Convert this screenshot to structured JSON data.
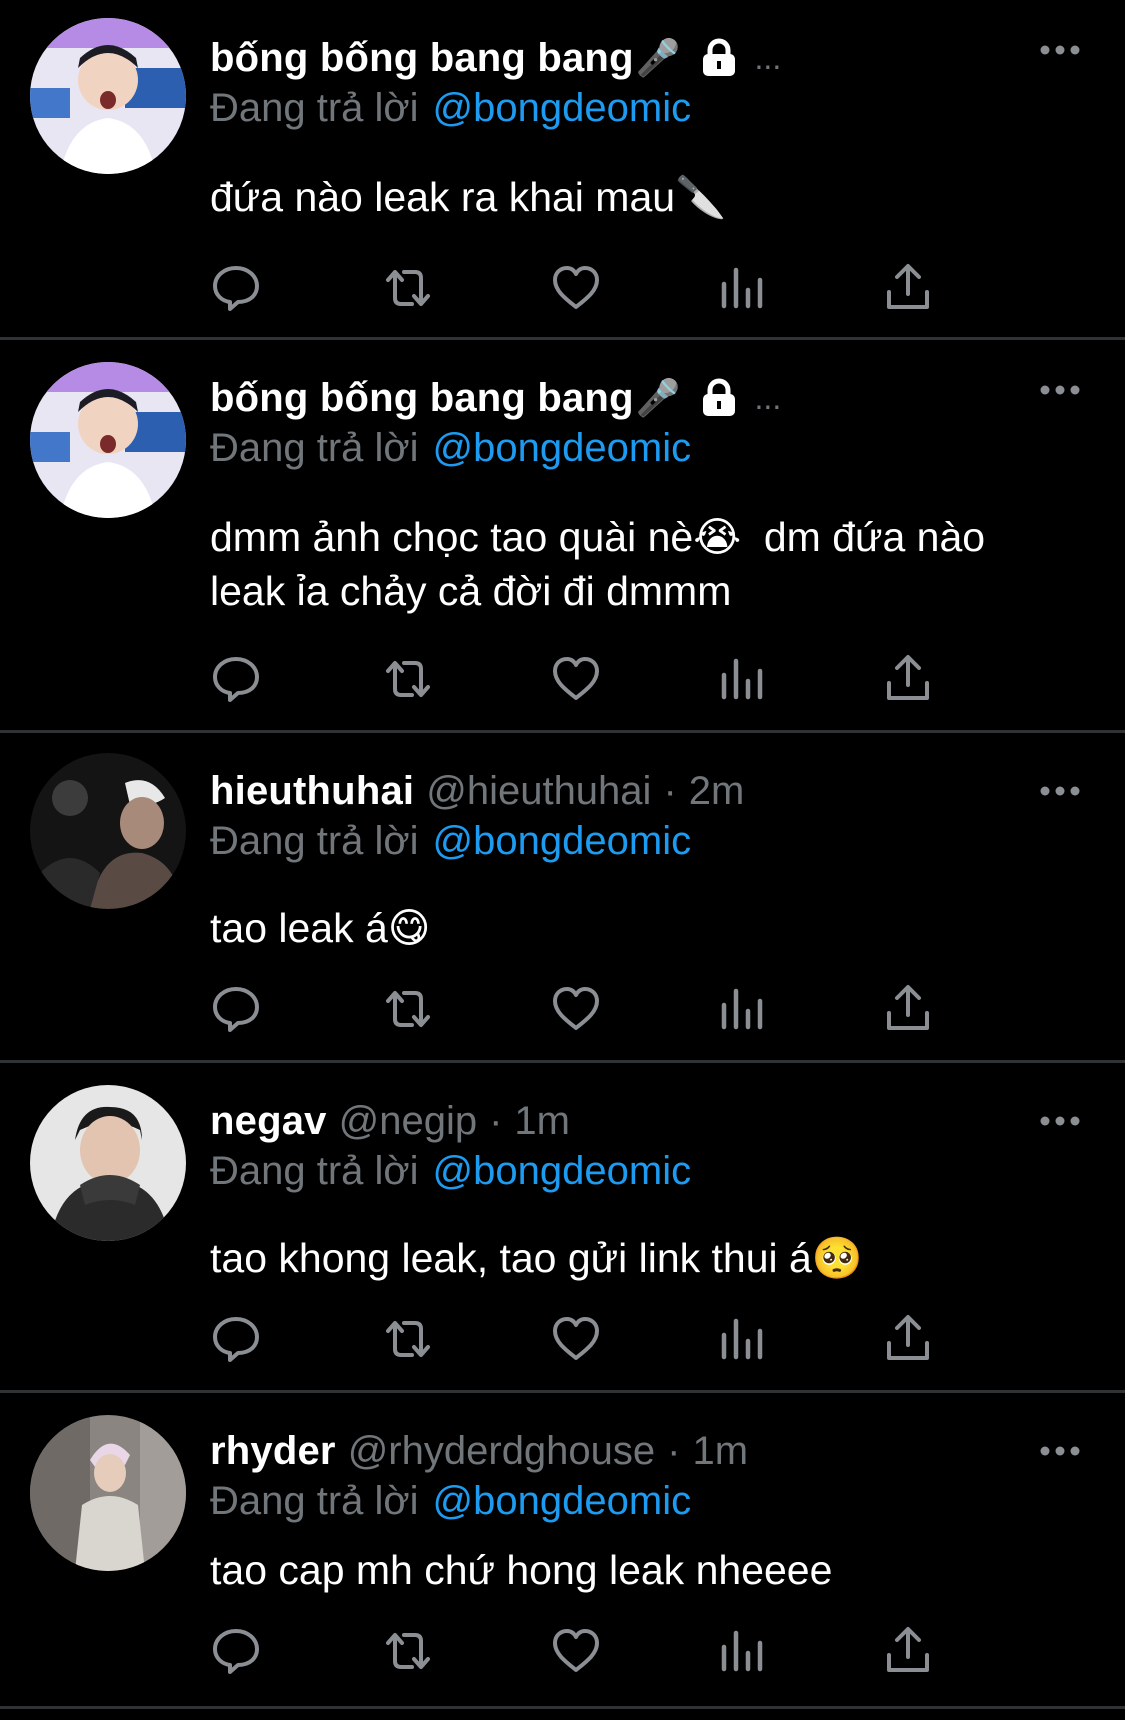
{
  "colors": {
    "background": "#000000",
    "text": "#ffffff",
    "muted": "#71767b",
    "link": "#1d9bf0",
    "divider": "#2f3336"
  },
  "icons": {
    "reply": "reply-icon",
    "retweet": "retweet-icon",
    "like": "heart-icon",
    "views": "analytics-icon",
    "share": "share-icon",
    "more": "more-icon",
    "protected": "lock-icon"
  },
  "tweets": [
    {
      "name": "bống bống bang bang",
      "name_emoji": "🎤",
      "protected": true,
      "truncation": "...",
      "reply_prefix": "Đang trả lời",
      "reply_handle": "@bongdeomic",
      "text": "đứa nào leak ra khai mau🔪"
    },
    {
      "name": "bống bống bang bang",
      "name_emoji": "🎤",
      "protected": true,
      "truncation": "...",
      "reply_prefix": "Đang trả lời",
      "reply_handle": "@bongdeomic",
      "text": "dmm ảnh chọc tao quài nè😭  dm đứa nào leak ỉa chảy cả đời đi dmmm"
    },
    {
      "name": "hieuthuhai",
      "handle": "@hieuthuhai",
      "separator": "·",
      "time": "2m",
      "reply_prefix": "Đang trả lời",
      "reply_handle": "@bongdeomic",
      "text": "tao leak á😋"
    },
    {
      "name": "negav",
      "handle": "@negip",
      "separator": "·",
      "time": "1m",
      "reply_prefix": "Đang trả lời",
      "reply_handle": "@bongdeomic",
      "text": "tao khong leak, tao gửi link thui á🥺"
    },
    {
      "name": "rhyder",
      "handle": "@rhyderdghouse",
      "separator": "·",
      "time": "1m",
      "reply_prefix": "Đang trả lời",
      "reply_handle": "@bongdeomic",
      "text": "tao cap mh chứ hong leak nheeee"
    }
  ]
}
